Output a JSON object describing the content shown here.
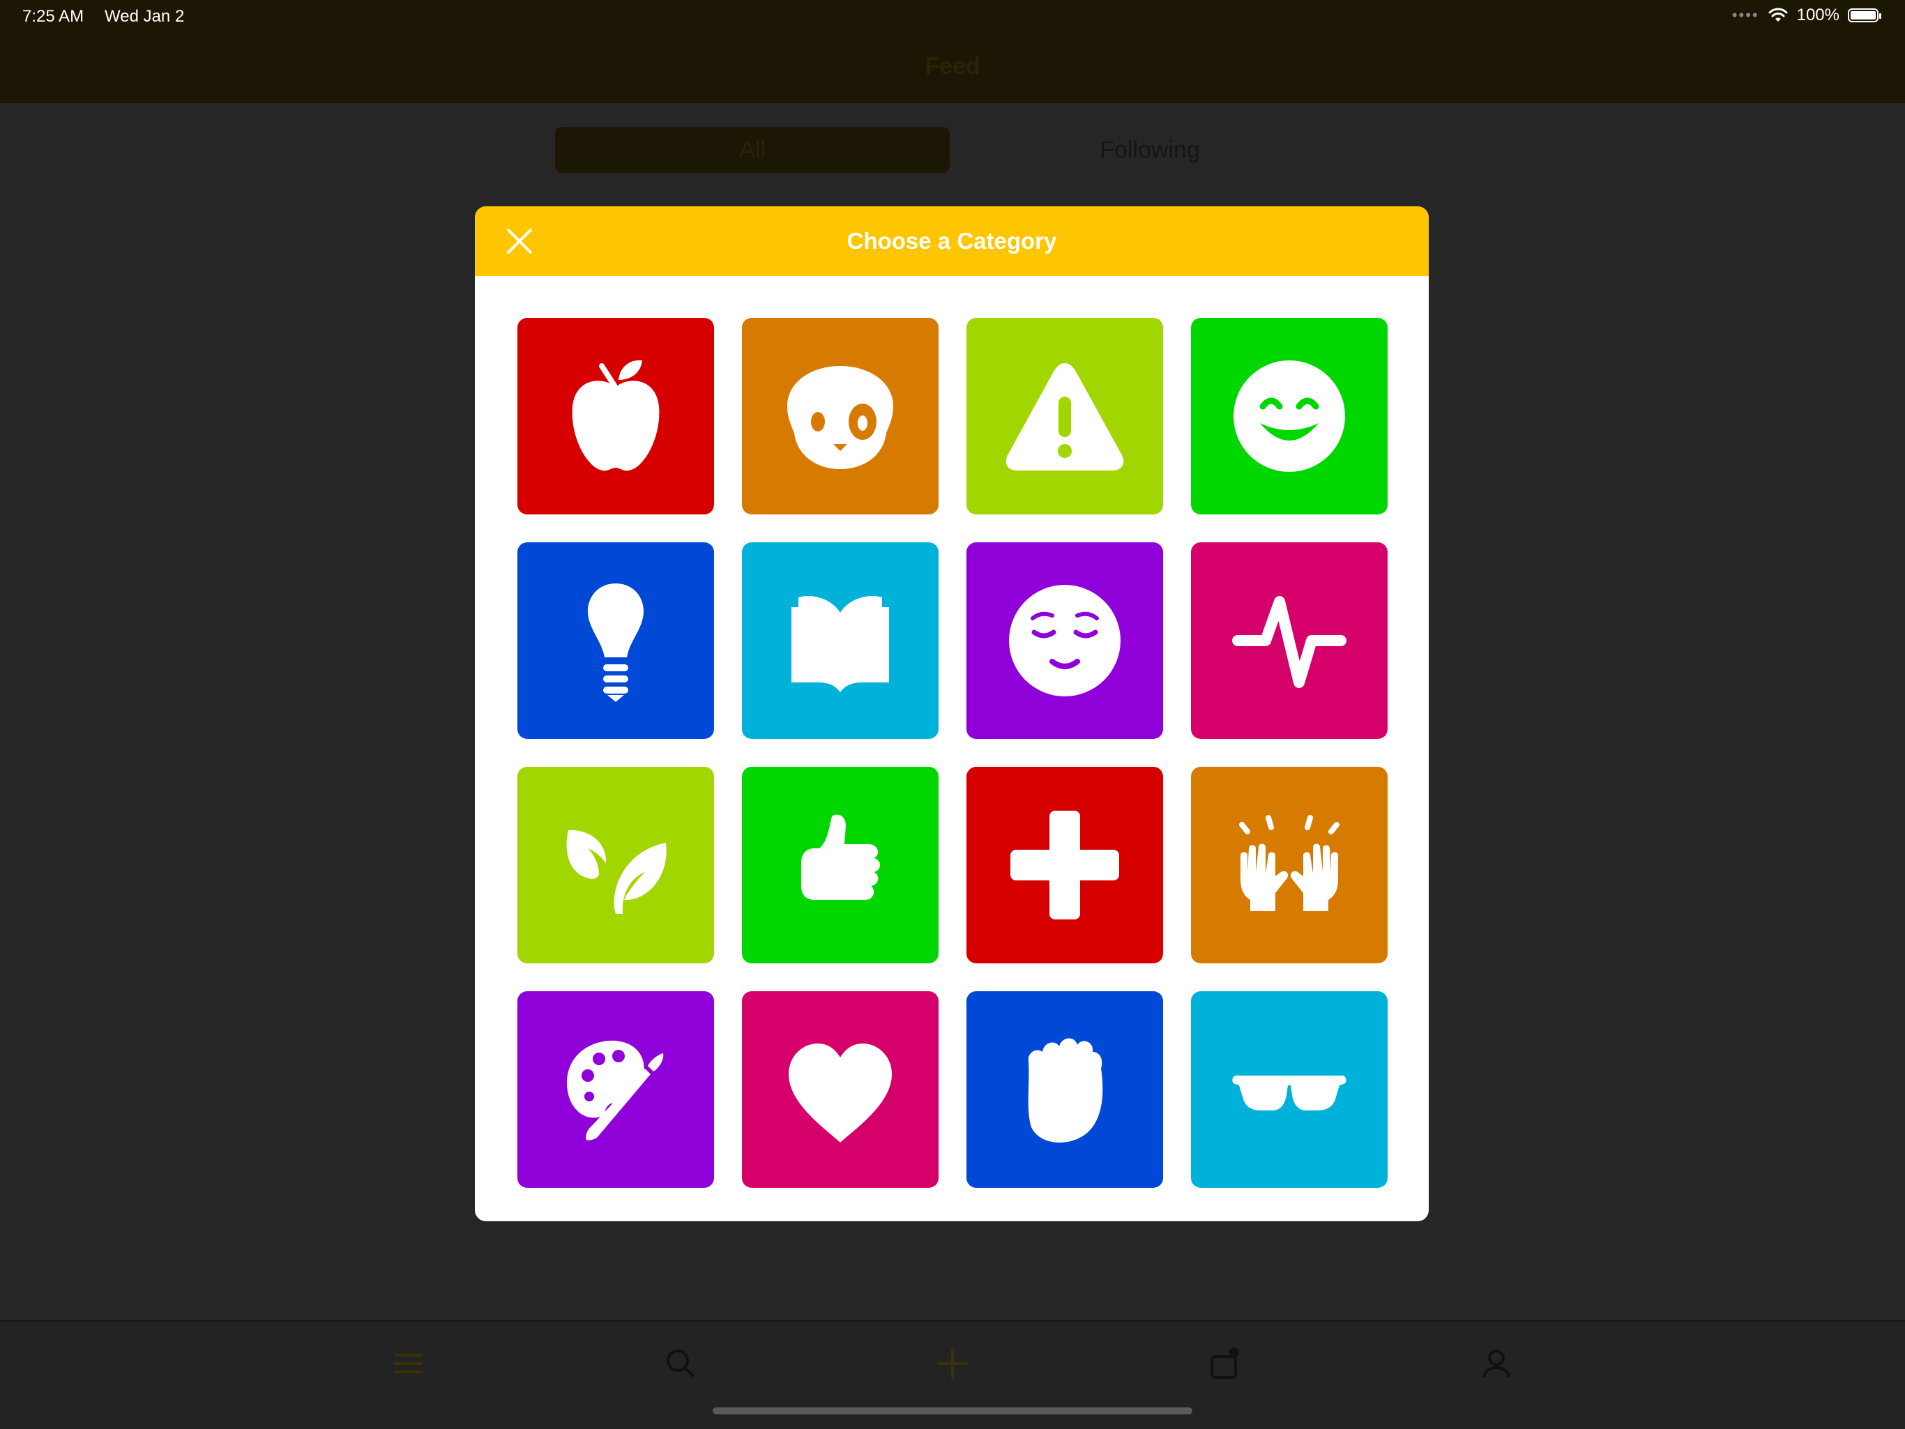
{
  "status_bar": {
    "time": "7:25 AM",
    "date": "Wed Jan 2",
    "battery": "100%"
  },
  "nav": {
    "title": "Feed"
  },
  "segments": {
    "all": "All",
    "following": "Following"
  },
  "modal": {
    "title": "Choose a Category"
  },
  "colors": {
    "header": "#fec600",
    "red": "#d60000",
    "orange": "#d67b00",
    "lime": "#a2d600",
    "green": "#00d600",
    "blue": "#0049d6",
    "cyan": "#00b2d9",
    "purple": "#9000d9",
    "magenta": "#d6006a"
  },
  "categories": [
    {
      "icon": "apple-icon",
      "color": "#d60000"
    },
    {
      "icon": "dog-icon",
      "color": "#d67b00"
    },
    {
      "icon": "warning-icon",
      "color": "#a2d600"
    },
    {
      "icon": "smile-icon",
      "color": "#00d600"
    },
    {
      "icon": "lightbulb-icon",
      "color": "#0049d6"
    },
    {
      "icon": "book-icon",
      "color": "#00b2d9"
    },
    {
      "icon": "relieved-face-icon",
      "color": "#9000d9"
    },
    {
      "icon": "heartbeat-icon",
      "color": "#d6006a"
    },
    {
      "icon": "leaves-icon",
      "color": "#a2d600"
    },
    {
      "icon": "thumbs-up-icon",
      "color": "#00d600"
    },
    {
      "icon": "medical-cross-icon",
      "color": "#d60000"
    },
    {
      "icon": "raised-hands-icon",
      "color": "#d67b00"
    },
    {
      "icon": "palette-icon",
      "color": "#9000d9"
    },
    {
      "icon": "heart-icon",
      "color": "#d6006a"
    },
    {
      "icon": "fist-icon",
      "color": "#0049d6"
    },
    {
      "icon": "sunglasses-icon",
      "color": "#00b2d9"
    }
  ],
  "tabbar": [
    "menu-icon",
    "search-icon",
    "add-icon",
    "shopping-bag-icon",
    "profile-icon"
  ]
}
